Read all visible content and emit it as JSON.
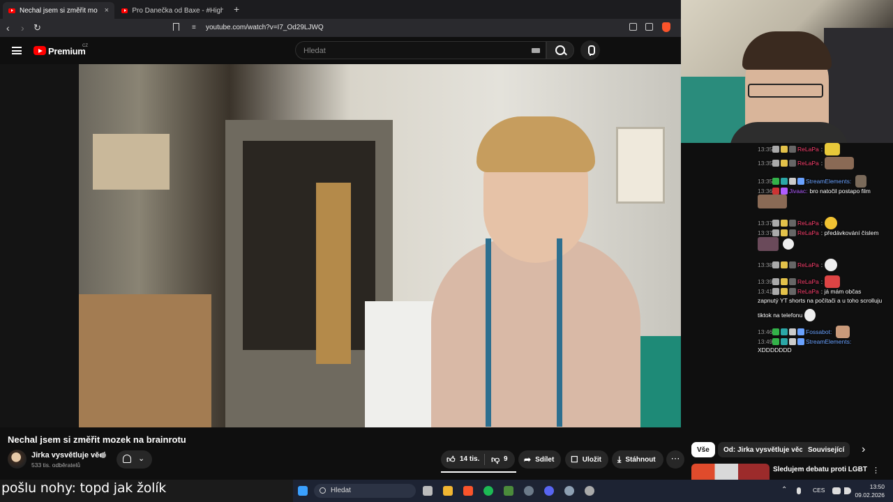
{
  "browser": {
    "tabs": [
      {
        "title": "Nechal jsem si změřit mozek na",
        "active": true
      },
      {
        "title": "Pro Danečka od Baxe - #Highlights",
        "active": false
      }
    ],
    "new_tab": "+",
    "close": "×",
    "url": "youtube.com/watch?v=I7_Od29LJWQ"
  },
  "youtube": {
    "brand": "Premium",
    "country": "CZ",
    "search_placeholder": "Hledat"
  },
  "chat": {
    "messages": [
      {
        "time": "13:35",
        "user": "ReLaPa",
        "user_color": "#ff3f6e",
        "text": ":"
      },
      {
        "time": "13:35",
        "user": "ReLaPa",
        "user_color": "#ff3f6e",
        "text": ":"
      },
      {
        "time": "13:35",
        "user": "StreamElements:",
        "user_color": "#6aa2ff",
        "text": ""
      },
      {
        "time": "13:36",
        "user": "Jivaac:",
        "user_color": "#b05cff",
        "text": "bro natočil postapo film"
      },
      {
        "time": "13:37",
        "user": "ReLaPa",
        "user_color": "#ff3f6e",
        "text": ":"
      },
      {
        "time": "13:37",
        "user": "ReLaPa",
        "user_color": "#ff3f6e",
        "text": ": předávkování číslem"
      },
      {
        "time": "13:38",
        "user": "ReLaPa",
        "user_color": "#ff3f6e",
        "text": ":"
      },
      {
        "time": "13:39",
        "user": "ReLaPa",
        "user_color": "#ff3f6e",
        "text": ":"
      },
      {
        "time": "13:41",
        "user": "ReLaPa",
        "user_color": "#ff3f6e",
        "text": ": já mám občas"
      },
      {
        "time": "",
        "user": "",
        "user_color": "#ffffff",
        "text": "zapnutý YT shorts na počítači a u toho scrolluju"
      },
      {
        "time": "",
        "user": "",
        "user_color": "#ffffff",
        "text": "tiktok na telefonu"
      },
      {
        "time": "13:46",
        "user": "Fossabot:",
        "user_color": "#6aa2ff",
        "text": ""
      },
      {
        "time": "13:49",
        "user": "StreamElements:",
        "user_color": "#6aa2ff",
        "text": ""
      },
      {
        "time": "",
        "user": "",
        "user_color": "#ffffff",
        "text": "XDDDDDDD"
      }
    ]
  },
  "video": {
    "title": "Nechal jsem si změřit mozek na brainrotu",
    "channel": "Jirka vysvětluje věci",
    "subscribers": "533 tis. odběratelů",
    "likes": "14 tis.",
    "dislikes": "9",
    "share": "Sdílet",
    "save": "Uložit",
    "download": "Stáhnout",
    "more": "⋯"
  },
  "chips": [
    "Vše",
    "Od: Jirka vysvětluje věci",
    "Související"
  ],
  "recommendation": {
    "title": "Sledujem debatu proti LGBT"
  },
  "caption": "pošlu nohy: topd jak žolík",
  "taskbar": {
    "search": "Hledat",
    "lang": "CES",
    "time": "13:50",
    "date": "09.02.2026"
  }
}
